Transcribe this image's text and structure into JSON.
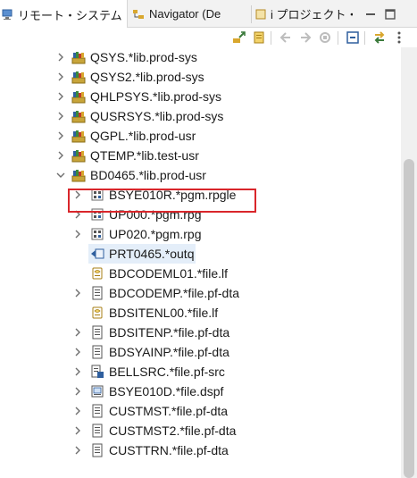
{
  "tabs": [
    {
      "label": "リモート・システム",
      "icon": "remote-systems-icon",
      "active": true,
      "close": "✕"
    },
    {
      "label": "Navigator (De",
      "icon": "navigator-icon",
      "active": false
    },
    {
      "label": "i プロジェクト・",
      "icon": "iproject-icon",
      "active": false
    }
  ],
  "toolbar": {
    "buttons": [
      "collapse-link-icon",
      "filter-icon",
      "back-icon",
      "forward-icon",
      "refresh-icon",
      "collapse-all-icon",
      "sync-icon",
      "view-menu-icon"
    ]
  },
  "tree": {
    "libraries": [
      {
        "label": "QSYS.*lib.prod-sys"
      },
      {
        "label": "QSYS2.*lib.prod-sys"
      },
      {
        "label": "QHLPSYS.*lib.prod-sys"
      },
      {
        "label": "QUSRSYS.*lib.prod-sys"
      },
      {
        "label": "QGPL.*lib.prod-usr"
      },
      {
        "label": "QTEMP.*lib.test-usr"
      },
      {
        "label": "BD0465.*lib.prod-usr",
        "expanded": true
      }
    ],
    "objects": [
      {
        "label": "BSYE010R.*pgm.rpgle",
        "type": "pgm",
        "expandable": true
      },
      {
        "label": "UP000.*pgm.rpg",
        "type": "pgm",
        "expandable": true
      },
      {
        "label": "UP020.*pgm.rpg",
        "type": "pgm",
        "expandable": true
      },
      {
        "label": "PRT0465.*outq",
        "type": "outq",
        "expandable": false,
        "selected": true
      },
      {
        "label": "BDCODEML01.*file.lf",
        "type": "lf",
        "expandable": false
      },
      {
        "label": "BDCODEMP.*file.pf-dta",
        "type": "pf",
        "expandable": true
      },
      {
        "label": "BDSITENL00.*file.lf",
        "type": "lf",
        "expandable": false
      },
      {
        "label": "BDSITENP.*file.pf-dta",
        "type": "pf",
        "expandable": true
      },
      {
        "label": "BDSYAINP.*file.pf-dta",
        "type": "pf",
        "expandable": true
      },
      {
        "label": "BELLSRC.*file.pf-src",
        "type": "src",
        "expandable": true
      },
      {
        "label": "BSYE010D.*file.dspf",
        "type": "dspf",
        "expandable": true
      },
      {
        "label": "CUSTMST.*file.pf-dta",
        "type": "pf",
        "expandable": true
      },
      {
        "label": "CUSTMST2.*file.pf-dta",
        "type": "pf",
        "expandable": true
      },
      {
        "label": "CUSTTRN.*file.pf-dta",
        "type": "pf",
        "expandable": true
      }
    ]
  },
  "colors": {
    "highlight_border": "#d9262b",
    "selection": "#e4eef9",
    "library_icon": "#c8a53a"
  }
}
